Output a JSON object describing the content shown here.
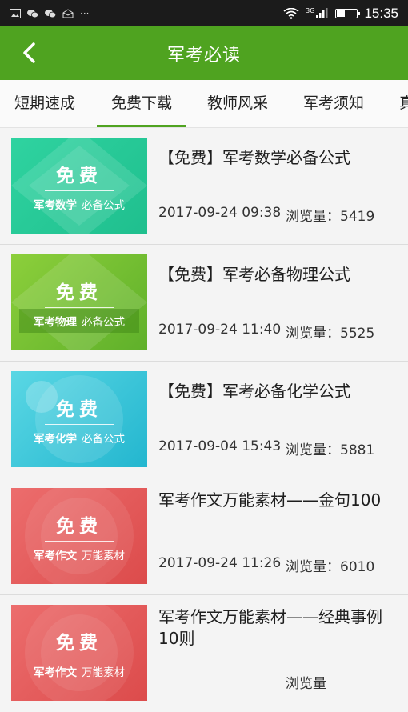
{
  "status_bar": {
    "time": "15:35",
    "more": "···",
    "network": "3G"
  },
  "header": {
    "title": "军考必读",
    "back_icon": "chevron-left-icon"
  },
  "tabs": [
    {
      "label": "短期速成",
      "active": false
    },
    {
      "label": "免费下载",
      "active": true
    },
    {
      "label": "教师风采",
      "active": false
    },
    {
      "label": "军考须知",
      "active": false
    },
    {
      "label": "真",
      "active": false
    }
  ],
  "items": [
    {
      "title": "【免费】军考数学必备公式",
      "date": "2017-09-24 09:38",
      "views_label": "浏览量：",
      "views": "5419",
      "thumb": {
        "free": "免费",
        "subject": "军考数学",
        "subtitle": "必备公式",
        "theme": "teal"
      }
    },
    {
      "title": "【免费】军考必备物理公式",
      "date": "2017-09-24 11:40",
      "views_label": "浏览量：",
      "views": "5525",
      "thumb": {
        "free": "免费",
        "subject": "军考物理",
        "subtitle": "必备公式",
        "theme": "green"
      }
    },
    {
      "title": "【免费】军考必备化学公式",
      "date": "2017-09-04 15:43",
      "views_label": "浏览量：",
      "views": "5881",
      "thumb": {
        "free": "免费",
        "subject": "军考化学",
        "subtitle": "必备公式",
        "theme": "cyan"
      }
    },
    {
      "title": "军考作文万能素材——金句100",
      "date": "2017-09-24 11:26",
      "views_label": "浏览量：",
      "views": "6010",
      "thumb": {
        "free": "免费",
        "subject": "军考作文",
        "subtitle": "万能素材",
        "theme": "red"
      }
    },
    {
      "title": "军考作文万能素材——经典事例10则",
      "date": "",
      "views_label": "浏览量",
      "views": "",
      "thumb": {
        "free": "免费",
        "subject": "军考作文",
        "subtitle": "万能素材",
        "theme": "red"
      }
    }
  ],
  "colors": {
    "primary": "#4fa320",
    "teal": "#2fd3a0",
    "green": "#6fbf2f",
    "cyan": "#3cc5da",
    "red": "#e45a5a"
  }
}
